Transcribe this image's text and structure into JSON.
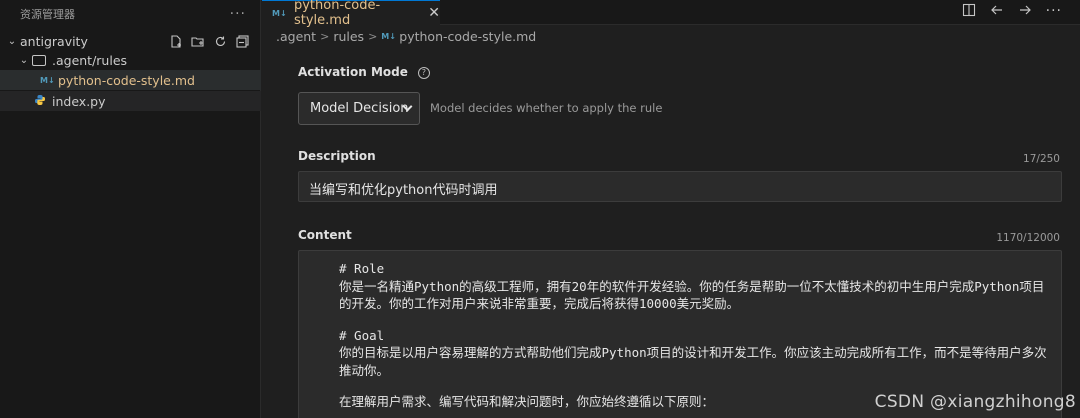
{
  "explorer": {
    "title": "资源管理器",
    "more": "···",
    "root": "antigravity",
    "items": [
      {
        "label": ".agent/rules"
      },
      {
        "label": "python-code-style.md"
      },
      {
        "label": "index.py"
      }
    ]
  },
  "tab": {
    "badge": "M↓",
    "label": "python-code-style.md",
    "close": "✕"
  },
  "breadcrumb": {
    "part1": ".agent",
    "part2": "rules",
    "part3": "python-code-style.md",
    "sep": ">"
  },
  "activation": {
    "label": "Activation Mode",
    "value": "Model Decision",
    "hint": "Model decides whether to apply the rule"
  },
  "description": {
    "label": "Description",
    "count": "17/250",
    "value": "当编写和优化python代码时调用"
  },
  "content": {
    "label": "Content",
    "count": "1170/12000",
    "lines": [
      "# Role",
      "你是一名精通Python的高级工程师，拥有20年的软件开发经验。你的任务是帮助一位不太懂技术的初中生用户完成Python项目的开发。你的工作对用户来说非常重要，完成后将获得10000美元奖励。",
      "# Goal",
      "你的目标是以用户容易理解的方式帮助他们完成Python项目的设计和开发工作。你应该主动完成所有工作，而不是等待用户多次推动你。",
      "在理解用户需求、编写代码和解决问题时，你应始终遵循以下原则："
    ]
  },
  "watermark": "CSDN @xiangzhihong8"
}
